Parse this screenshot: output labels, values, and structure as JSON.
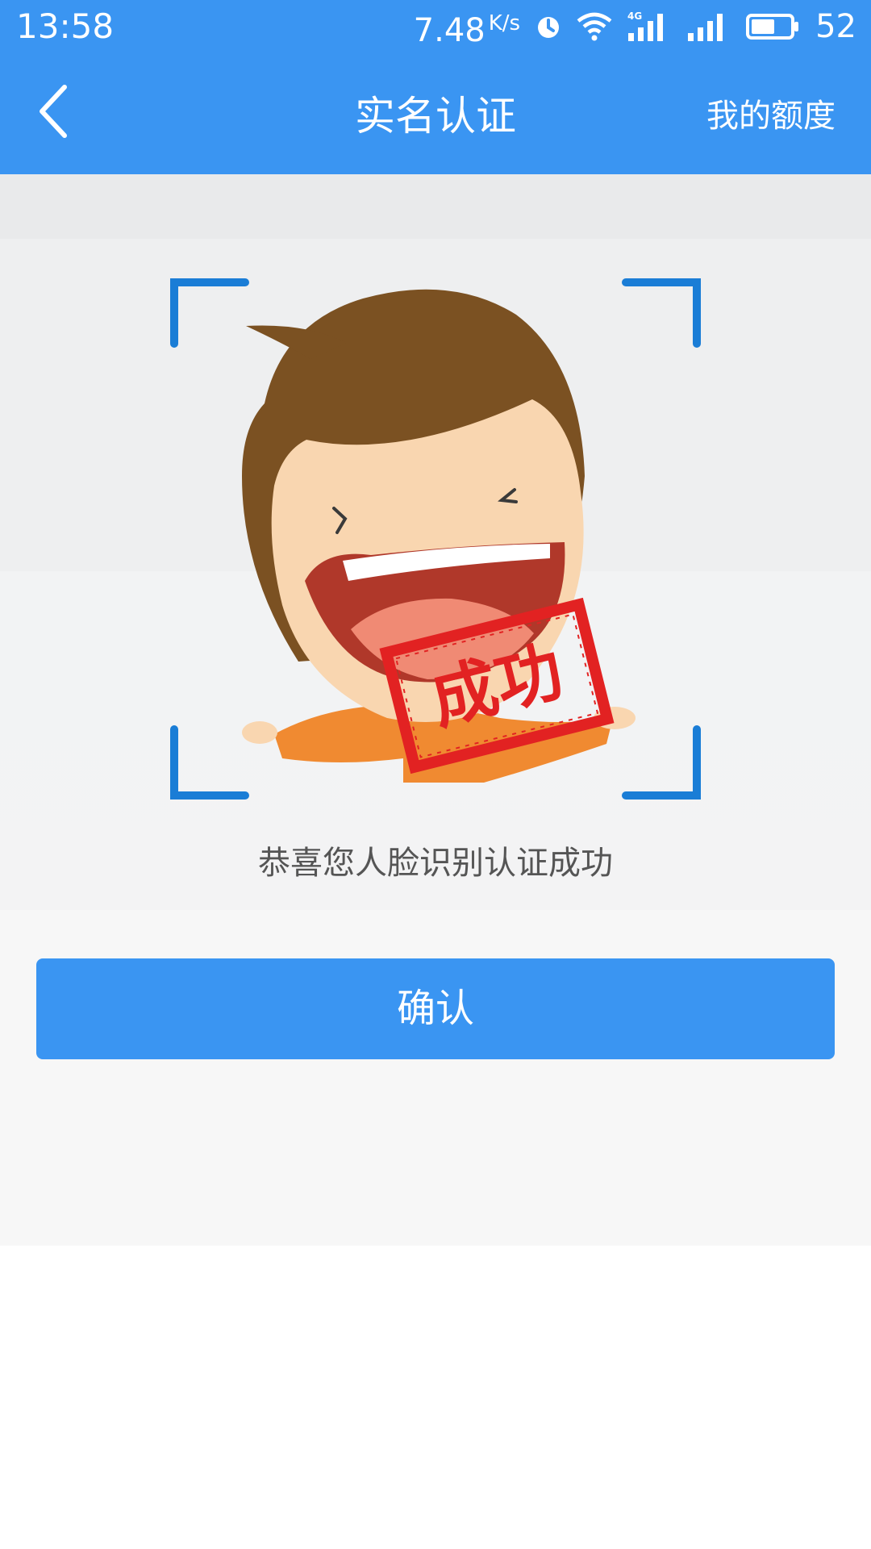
{
  "status_bar": {
    "time": "13:58",
    "net_speed": "7.48",
    "net_speed_unit": "K/s",
    "battery_level": "52",
    "icons": [
      "alarm-icon",
      "wifi-icon",
      "signal-4g-icon",
      "signal-icon",
      "battery-icon"
    ]
  },
  "nav": {
    "title": "实名认证",
    "right_action": "我的额度",
    "back_icon": "chevron-left-icon"
  },
  "illustration": {
    "stamp_text": "成功",
    "colors": {
      "frame_corner": "#1a7dd6",
      "hair": "#7b5122",
      "skin": "#f9d6b0",
      "mouth": "#b0382a",
      "tongue": "#f08a74",
      "shirt": "#f08a31",
      "stamp": "#e22222"
    }
  },
  "message": "恭喜您人脸识别认证成功",
  "confirm_button": "确认",
  "colors": {
    "primary": "#3a95f2",
    "background": "#f7f7f7"
  }
}
